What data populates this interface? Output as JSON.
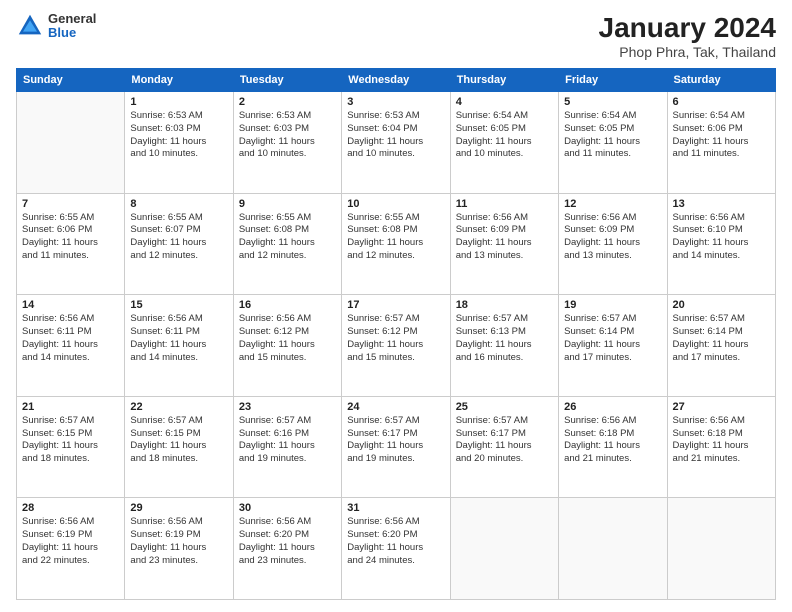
{
  "header": {
    "logo": {
      "general": "General",
      "blue": "Blue"
    },
    "title": "January 2024",
    "subtitle": "Phop Phra, Tak, Thailand"
  },
  "calendar": {
    "headers": [
      "Sunday",
      "Monday",
      "Tuesday",
      "Wednesday",
      "Thursday",
      "Friday",
      "Saturday"
    ],
    "weeks": [
      [
        {
          "day": "",
          "info": ""
        },
        {
          "day": "1",
          "info": "Sunrise: 6:53 AM\nSunset: 6:03 PM\nDaylight: 11 hours\nand 10 minutes."
        },
        {
          "day": "2",
          "info": "Sunrise: 6:53 AM\nSunset: 6:03 PM\nDaylight: 11 hours\nand 10 minutes."
        },
        {
          "day": "3",
          "info": "Sunrise: 6:53 AM\nSunset: 6:04 PM\nDaylight: 11 hours\nand 10 minutes."
        },
        {
          "day": "4",
          "info": "Sunrise: 6:54 AM\nSunset: 6:05 PM\nDaylight: 11 hours\nand 10 minutes."
        },
        {
          "day": "5",
          "info": "Sunrise: 6:54 AM\nSunset: 6:05 PM\nDaylight: 11 hours\nand 11 minutes."
        },
        {
          "day": "6",
          "info": "Sunrise: 6:54 AM\nSunset: 6:06 PM\nDaylight: 11 hours\nand 11 minutes."
        }
      ],
      [
        {
          "day": "7",
          "info": "Sunrise: 6:55 AM\nSunset: 6:06 PM\nDaylight: 11 hours\nand 11 minutes."
        },
        {
          "day": "8",
          "info": "Sunrise: 6:55 AM\nSunset: 6:07 PM\nDaylight: 11 hours\nand 12 minutes."
        },
        {
          "day": "9",
          "info": "Sunrise: 6:55 AM\nSunset: 6:08 PM\nDaylight: 11 hours\nand 12 minutes."
        },
        {
          "day": "10",
          "info": "Sunrise: 6:55 AM\nSunset: 6:08 PM\nDaylight: 11 hours\nand 12 minutes."
        },
        {
          "day": "11",
          "info": "Sunrise: 6:56 AM\nSunset: 6:09 PM\nDaylight: 11 hours\nand 13 minutes."
        },
        {
          "day": "12",
          "info": "Sunrise: 6:56 AM\nSunset: 6:09 PM\nDaylight: 11 hours\nand 13 minutes."
        },
        {
          "day": "13",
          "info": "Sunrise: 6:56 AM\nSunset: 6:10 PM\nDaylight: 11 hours\nand 14 minutes."
        }
      ],
      [
        {
          "day": "14",
          "info": "Sunrise: 6:56 AM\nSunset: 6:11 PM\nDaylight: 11 hours\nand 14 minutes."
        },
        {
          "day": "15",
          "info": "Sunrise: 6:56 AM\nSunset: 6:11 PM\nDaylight: 11 hours\nand 14 minutes."
        },
        {
          "day": "16",
          "info": "Sunrise: 6:56 AM\nSunset: 6:12 PM\nDaylight: 11 hours\nand 15 minutes."
        },
        {
          "day": "17",
          "info": "Sunrise: 6:57 AM\nSunset: 6:12 PM\nDaylight: 11 hours\nand 15 minutes."
        },
        {
          "day": "18",
          "info": "Sunrise: 6:57 AM\nSunset: 6:13 PM\nDaylight: 11 hours\nand 16 minutes."
        },
        {
          "day": "19",
          "info": "Sunrise: 6:57 AM\nSunset: 6:14 PM\nDaylight: 11 hours\nand 17 minutes."
        },
        {
          "day": "20",
          "info": "Sunrise: 6:57 AM\nSunset: 6:14 PM\nDaylight: 11 hours\nand 17 minutes."
        }
      ],
      [
        {
          "day": "21",
          "info": "Sunrise: 6:57 AM\nSunset: 6:15 PM\nDaylight: 11 hours\nand 18 minutes."
        },
        {
          "day": "22",
          "info": "Sunrise: 6:57 AM\nSunset: 6:15 PM\nDaylight: 11 hours\nand 18 minutes."
        },
        {
          "day": "23",
          "info": "Sunrise: 6:57 AM\nSunset: 6:16 PM\nDaylight: 11 hours\nand 19 minutes."
        },
        {
          "day": "24",
          "info": "Sunrise: 6:57 AM\nSunset: 6:17 PM\nDaylight: 11 hours\nand 19 minutes."
        },
        {
          "day": "25",
          "info": "Sunrise: 6:57 AM\nSunset: 6:17 PM\nDaylight: 11 hours\nand 20 minutes."
        },
        {
          "day": "26",
          "info": "Sunrise: 6:56 AM\nSunset: 6:18 PM\nDaylight: 11 hours\nand 21 minutes."
        },
        {
          "day": "27",
          "info": "Sunrise: 6:56 AM\nSunset: 6:18 PM\nDaylight: 11 hours\nand 21 minutes."
        }
      ],
      [
        {
          "day": "28",
          "info": "Sunrise: 6:56 AM\nSunset: 6:19 PM\nDaylight: 11 hours\nand 22 minutes."
        },
        {
          "day": "29",
          "info": "Sunrise: 6:56 AM\nSunset: 6:19 PM\nDaylight: 11 hours\nand 23 minutes."
        },
        {
          "day": "30",
          "info": "Sunrise: 6:56 AM\nSunset: 6:20 PM\nDaylight: 11 hours\nand 23 minutes."
        },
        {
          "day": "31",
          "info": "Sunrise: 6:56 AM\nSunset: 6:20 PM\nDaylight: 11 hours\nand 24 minutes."
        },
        {
          "day": "",
          "info": ""
        },
        {
          "day": "",
          "info": ""
        },
        {
          "day": "",
          "info": ""
        }
      ]
    ]
  }
}
